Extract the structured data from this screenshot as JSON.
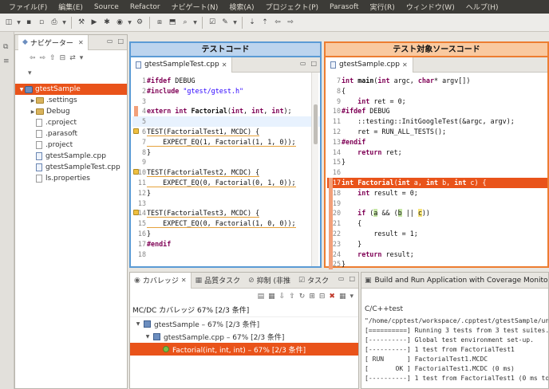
{
  "menu": [
    "ファイル(F)",
    "編集(E)",
    "Source",
    "Refactor",
    "ナビゲート(N)",
    "検索(A)",
    "プロジェクト(P)",
    "Parasoft",
    "実行(R)",
    "ウィンドウ(W)",
    "ヘルプ(H)"
  ],
  "toolbar_icons": [
    "new-icon",
    "save-icon",
    "save-all-icon",
    "print-icon",
    "build-icon",
    "run-icon",
    "debug-icon",
    "coverage-icon",
    "external-tools-icon",
    "open-type-icon",
    "open-resource-icon",
    "search-icon",
    "task-icon",
    "pen-icon",
    "next-annotation-icon",
    "prev-annotation-icon",
    "back-icon",
    "forward-icon"
  ],
  "navigator": {
    "title": "ナビゲーター",
    "tree": [
      {
        "label": "gtestSample",
        "level": 0,
        "expanded": true,
        "kind": "project",
        "selected": true
      },
      {
        "label": ".settings",
        "level": 1,
        "expanded": false,
        "kind": "folder"
      },
      {
        "label": "Debug",
        "level": 1,
        "expanded": false,
        "kind": "folder"
      },
      {
        "label": ".cproject",
        "level": 1,
        "kind": "file"
      },
      {
        "label": ".parasoft",
        "level": 1,
        "kind": "file"
      },
      {
        "label": ".project",
        "level": 1,
        "kind": "file"
      },
      {
        "label": "gtestSample.cpp",
        "level": 1,
        "kind": "cfile"
      },
      {
        "label": "gtestSampleTest.cpp",
        "level": 1,
        "kind": "cfile"
      },
      {
        "label": "ls.properties",
        "level": 1,
        "kind": "file"
      }
    ]
  },
  "banners": {
    "left": "テストコード",
    "right": "テスト対象ソースコード"
  },
  "left_editor": {
    "tab": "gtestSampleTest.cpp",
    "lines": [
      {
        "n": "1",
        "html": "<span class='kw'>#ifdef</span> DEBUG"
      },
      {
        "n": "2",
        "html": "<span class='kw'>#include</span> <span class='str'>\"gtest/gtest.h\"</span>"
      },
      {
        "n": "3",
        "html": ""
      },
      {
        "n": "4",
        "html": "<span class='kw'>extern int</span> <span class='fn'>Factorial</span>(<span class='kw'>int</span>, <span class='kw'>int</span>, <span class='kw'>int</span>);"
      },
      {
        "n": "5",
        "html": "",
        "cls": "curline"
      },
      {
        "n": "6",
        "html": "<span class='uline'>TEST(FactorialTest1, MCDC) {</span>"
      },
      {
        "n": "7",
        "html": "<span class='uline'>    EXPECT_EQ(1, Factorial(1, 1, 0));</span>"
      },
      {
        "n": "8",
        "html": "}"
      },
      {
        "n": "9",
        "html": ""
      },
      {
        "n": "10",
        "html": "<span class='uline'>TEST(FactorialTest2, MCDC) {</span>"
      },
      {
        "n": "11",
        "html": "<span class='uline'>    EXPECT_EQ(0, Factorial(0, 1, 0));</span>"
      },
      {
        "n": "12",
        "html": "}"
      },
      {
        "n": "13",
        "html": ""
      },
      {
        "n": "14",
        "html": "<span class='uline'>TEST(FactorialTest3, MCDC) {</span>"
      },
      {
        "n": "15",
        "html": "<span class='uline'>    EXPECT_EQ(0, Factorial(1, 0, 0));</span>"
      },
      {
        "n": "16",
        "html": "}"
      },
      {
        "n": "17",
        "html": "<span class='kw'>#endif</span>"
      },
      {
        "n": "18",
        "html": ""
      }
    ]
  },
  "right_editor": {
    "tab": "gtestSample.cpp",
    "lines": [
      {
        "n": "7",
        "html": "<span class='kw'>int</span> <span class='fn'>main</span>(<span class='kw'>int</span> argc, <span class='kw'>char</span>* argv[])"
      },
      {
        "n": "8",
        "html": "{"
      },
      {
        "n": "9",
        "html": "    <span class='kw'>int</span> ret = 0;"
      },
      {
        "n": "10",
        "html": "<span class='kw'>#ifdef</span> DEBUG"
      },
      {
        "n": "11",
        "html": "    ::testing::InitGoogleTest(&amp;argc, argv);"
      },
      {
        "n": "12",
        "html": "    ret = RUN_ALL_TESTS();"
      },
      {
        "n": "13",
        "html": "<span class='kw'>#endif</span>"
      },
      {
        "n": "14",
        "html": "    <span class='kw'>return</span> ret;"
      },
      {
        "n": "15",
        "html": "}"
      },
      {
        "n": "16",
        "html": ""
      },
      {
        "n": "17",
        "html": "<span class='kw'>int</span> <span class='fn'>Factorial</span>(<span class='kw'>int</span> a, <span class='kw'>int</span> b, <span class='kw'>int</span> c) {",
        "cls": "hl"
      },
      {
        "n": "18",
        "html": "    <span class='kw'>int</span> result = 0;"
      },
      {
        "n": "19",
        "html": ""
      },
      {
        "n": "20",
        "html": "    <span class='kw'>if</span> (<span class='gb'>a</span> &amp;&amp; (<span class='gb'>b</span> || <span class='yb'>c</span>))"
      },
      {
        "n": "21",
        "html": "    {"
      },
      {
        "n": "22",
        "html": "        result = 1;"
      },
      {
        "n": "23",
        "html": "    }"
      },
      {
        "n": "24",
        "html": "    <span class='kw'>return</span> result;"
      },
      {
        "n": "25",
        "html": "}"
      }
    ]
  },
  "coverage_view": {
    "tabs": [
      "カバレッジ",
      "品質タスク",
      "抑制 (非推",
      "タスク"
    ],
    "summary": "MC/DC カバレッジ 67% [2/3 条件]",
    "rows": [
      {
        "label": "gtestSample – 67% [2/3 条件]",
        "level": 0
      },
      {
        "label": "gtestSample.cpp – 67% [2/3 条件]",
        "level": 1
      },
      {
        "label": "Factorial(int, int, int) – 67% [2/3 条件]",
        "level": 2,
        "selected": true
      }
    ]
  },
  "console": {
    "title": "Build and Run Application with Coverage Monitoring ...",
    "label": "C/C++test",
    "lines": [
      "\"/home/cpptest/workspace/.cpptest/gtestSample/uni",
      "[==========] Running 3 tests from 3 test suites.",
      "[----------] Global test environment set-up.",
      "[----------] 1 test from FactorialTest1",
      "[ RUN      ] FactorialTest1.MCDC",
      "[       OK ] FactorialTest1.MCDC (0 ms)",
      "[----------] 1 test from FactorialTest1 (0 ms tot"
    ]
  }
}
